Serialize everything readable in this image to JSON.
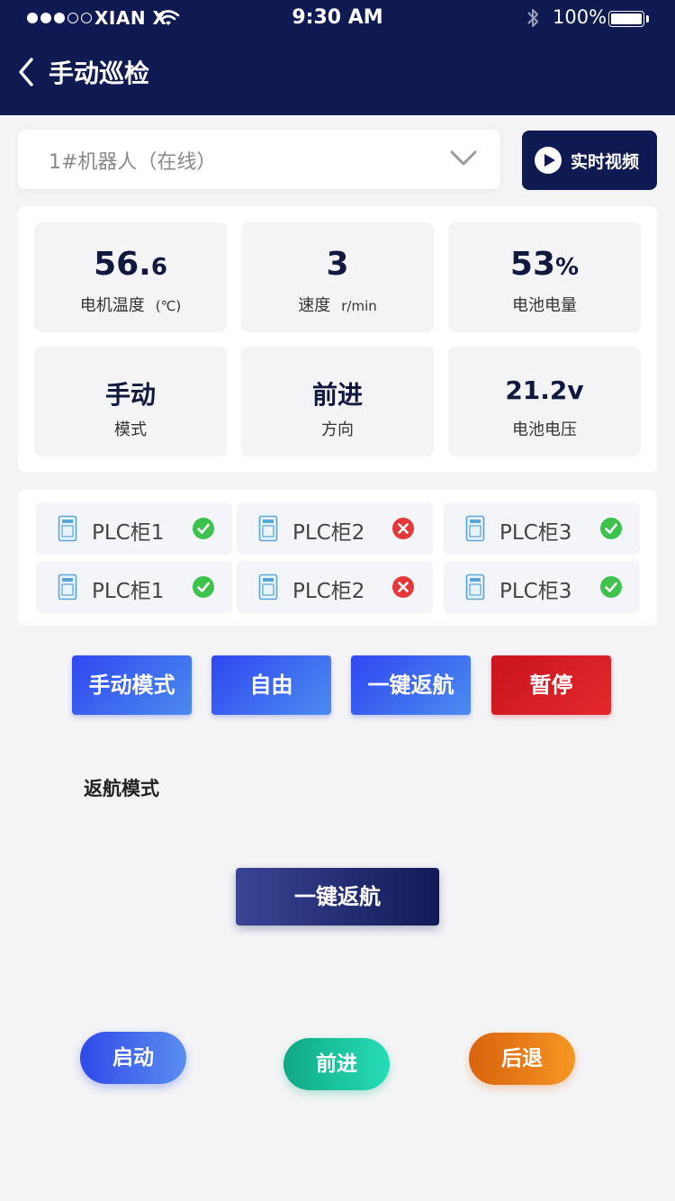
{
  "status_bar": {
    "carrier": "XIAN X",
    "time": "9:30 AM",
    "battery": "100%"
  },
  "header": {
    "title": "手动巡检"
  },
  "robot_select": {
    "value": "1#机器人（在线）"
  },
  "video_button": {
    "label": "实时视频"
  },
  "stats": {
    "motor_temp": {
      "value_int": "56.",
      "value_dec": "6",
      "label": "电机温度",
      "unit": "(℃)"
    },
    "speed": {
      "value": "3",
      "label": "速度",
      "unit": "r/min"
    },
    "battery_level": {
      "value_num": "53",
      "value_unit": "%",
      "label": "电池电量"
    },
    "mode": {
      "value": "手动",
      "label": "模式"
    },
    "direction": {
      "value": "前进",
      "label": "方向"
    },
    "battery_voltage": {
      "value": "21.2v",
      "label": "电池电压"
    }
  },
  "plc_cabinets": [
    {
      "label": "PLC柜1",
      "status": "ok"
    },
    {
      "label": "PLC柜2",
      "status": "error"
    },
    {
      "label": "PLC柜3",
      "status": "ok"
    },
    {
      "label": "PLC柜1",
      "status": "ok"
    },
    {
      "label": "PLC柜2",
      "status": "error"
    },
    {
      "label": "PLC柜3",
      "status": "ok"
    }
  ],
  "mode_buttons": {
    "manual": "手动模式",
    "free": "自由",
    "one_key_return": "一键返航",
    "pause": "暂停"
  },
  "return_section": {
    "title": "返航模式",
    "button": "一键返航"
  },
  "controls": {
    "start": "启动",
    "forward": "前进",
    "backward": "后退"
  },
  "colors": {
    "header_bg": "#0f1a52",
    "ok_green": "#3ec24e",
    "error_red": "#e5383b",
    "accent_blue": "#2f47f0",
    "pause_red": "#c8141e"
  }
}
